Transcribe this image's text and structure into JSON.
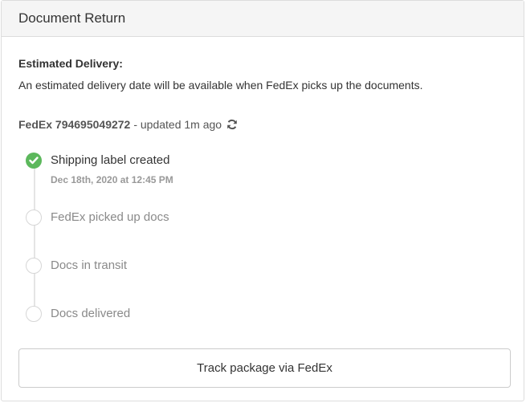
{
  "panel": {
    "title": "Document Return"
  },
  "estimated_delivery": {
    "label": "Estimated Delivery:",
    "text": "An estimated delivery date will be available when FedEx picks up the documents."
  },
  "tracking": {
    "carrier_number": "FedEx 794695049272",
    "updated": "- updated 1m ago",
    "refresh_icon": "refresh-icon"
  },
  "steps": [
    {
      "label": "Shipping label created",
      "date": "Dec 18th, 2020 at 12:45 PM",
      "status": "done"
    },
    {
      "label": "FedEx picked up docs",
      "status": "pending"
    },
    {
      "label": "Docs in transit",
      "status": "pending"
    },
    {
      "label": "Docs delivered",
      "status": "pending"
    }
  ],
  "track_button": {
    "label": "Track package via FedEx"
  },
  "colors": {
    "success": "#5cb85c",
    "header_bg": "#f5f5f5",
    "border": "#dddddd"
  }
}
